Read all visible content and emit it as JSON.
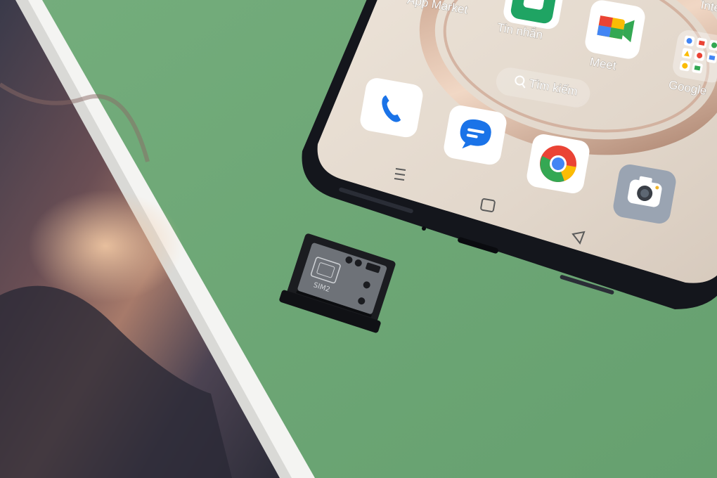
{
  "apps": {
    "app_market": "App Market",
    "messages": "Tin nhắn",
    "meet": "Meet",
    "google": "Google",
    "partial_right": "Inte"
  },
  "search": {
    "label": "Tìm kiếm"
  },
  "sim_tray": {
    "label": "SIM2"
  },
  "colors": {
    "mat": "#6ea877",
    "phone_frame": "#14161c",
    "screen": "#e6ddd3",
    "chrome_red": "#ea4335",
    "chrome_green": "#34a853",
    "chrome_yellow": "#fbbc04",
    "chrome_blue": "#4285f4"
  },
  "icons": [
    "phone-app-icon",
    "messages-app-icon",
    "chrome-app-icon",
    "camera-app-icon",
    "meet-app-icon",
    "google-folder-icon",
    "search-icon"
  ]
}
